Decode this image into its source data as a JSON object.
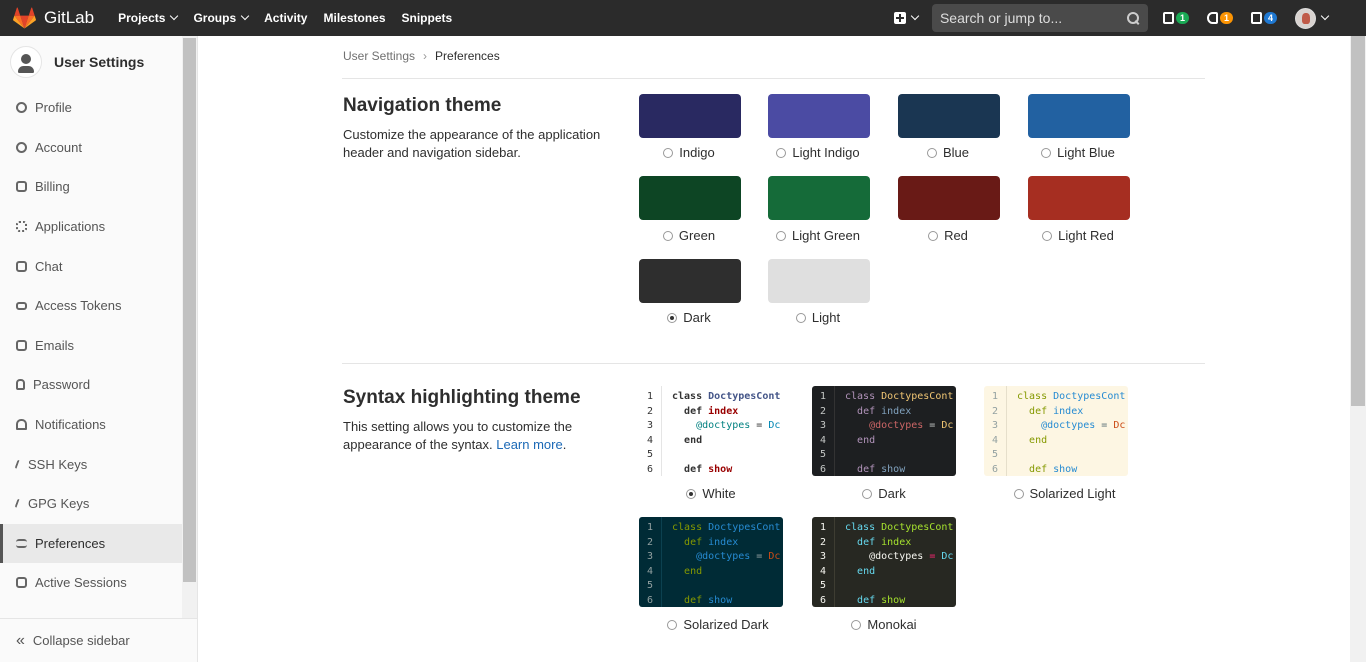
{
  "topbar": {
    "brand": "GitLab",
    "nav": [
      "Projects",
      "Groups",
      "Activity",
      "Milestones",
      "Snippets"
    ],
    "search_placeholder": "Search or jump to...",
    "badges": {
      "issues": "1",
      "merge_requests": "1",
      "todos": "4"
    },
    "badge_colors": {
      "issues": "#1aaa55",
      "merge_requests": "#fc9403",
      "todos": "#1f78d1"
    }
  },
  "sidebar": {
    "title": "User Settings",
    "items": [
      {
        "label": "Profile",
        "icon": "profile-icon"
      },
      {
        "label": "Account",
        "icon": "account-icon"
      },
      {
        "label": "Billing",
        "icon": "credit-card-icon"
      },
      {
        "label": "Applications",
        "icon": "grid-icon"
      },
      {
        "label": "Chat",
        "icon": "chat-bubble-icon"
      },
      {
        "label": "Access Tokens",
        "icon": "key-row-icon"
      },
      {
        "label": "Emails",
        "icon": "mail-icon"
      },
      {
        "label": "Password",
        "icon": "lock-icon"
      },
      {
        "label": "Notifications",
        "icon": "bell-icon"
      },
      {
        "label": "SSH Keys",
        "icon": "key-icon"
      },
      {
        "label": "GPG Keys",
        "icon": "key-icon"
      },
      {
        "label": "Preferences",
        "icon": "preferences-icon",
        "active": true
      },
      {
        "label": "Active Sessions",
        "icon": "monitor-icon"
      }
    ],
    "collapse_label": "Collapse sidebar"
  },
  "breadcrumb": {
    "parent": "User Settings",
    "current": "Preferences"
  },
  "navigation_theme": {
    "title": "Navigation theme",
    "description": "Customize the appearance of the application header and navigation sidebar.",
    "themes": [
      {
        "name": "Indigo",
        "color": "#292961",
        "selected": false
      },
      {
        "name": "Light Indigo",
        "color": "#4b4ba3",
        "selected": false
      },
      {
        "name": "Blue",
        "color": "#1a3652",
        "selected": false
      },
      {
        "name": "Light Blue",
        "color": "#2261a1",
        "selected": false
      },
      {
        "name": "Green",
        "color": "#0d4524",
        "selected": false
      },
      {
        "name": "Light Green",
        "color": "#156b39",
        "selected": false
      },
      {
        "name": "Red",
        "color": "#691a16",
        "selected": false
      },
      {
        "name": "Light Red",
        "color": "#a62e21",
        "selected": false
      },
      {
        "name": "Dark",
        "color": "#2e2e2e",
        "selected": true
      },
      {
        "name": "Light",
        "color": "#dfdfdf",
        "selected": false
      }
    ]
  },
  "syntax_theme": {
    "title": "Syntax highlighting theme",
    "description": "This setting allows you to customize the appearance of the syntax.",
    "learn_more": "Learn more",
    "themes": [
      {
        "name": "White",
        "selected": true
      },
      {
        "name": "Dark",
        "selected": false
      },
      {
        "name": "Solarized Light",
        "selected": false
      },
      {
        "name": "Solarized Dark",
        "selected": false
      },
      {
        "name": "Monokai",
        "selected": false
      }
    ],
    "code_lines": [
      "class DoctypesCont",
      "  def index",
      "    @doctypes = Dc",
      "  end",
      "",
      "  def show"
    ]
  }
}
